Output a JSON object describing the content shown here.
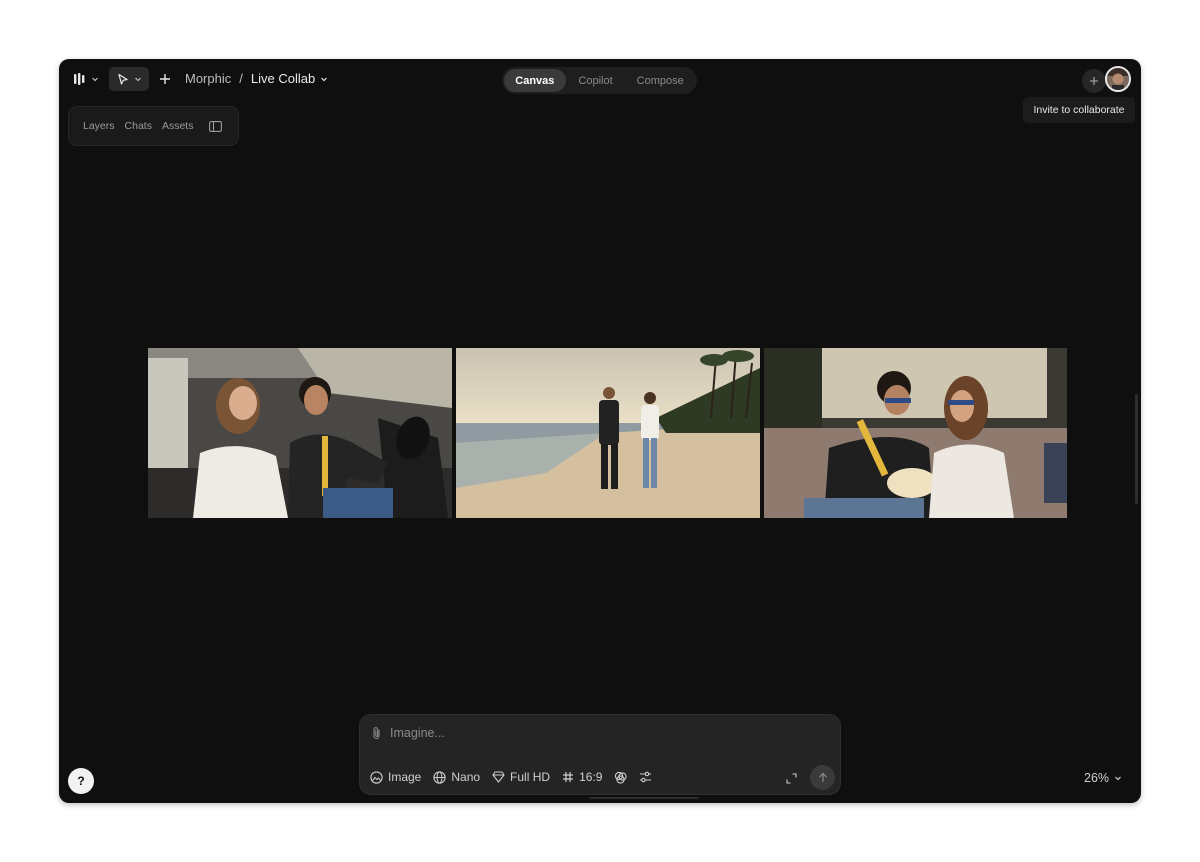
{
  "header": {
    "breadcrumb_root": "Morphic",
    "breadcrumb_separator": "/",
    "breadcrumb_current": "Live Collab",
    "modes": [
      {
        "label": "Canvas",
        "active": true
      },
      {
        "label": "Copilot",
        "active": false
      },
      {
        "label": "Compose",
        "active": false
      }
    ],
    "tooltip": "Invite to collaborate"
  },
  "panel": {
    "tabs": [
      "Layers",
      "Chats",
      "Assets"
    ]
  },
  "canvas": {
    "images": [
      {
        "name": "couple-in-car"
      },
      {
        "name": "couple-walking-beach"
      },
      {
        "name": "couple-watching-movie"
      }
    ]
  },
  "prompt": {
    "placeholder": "Imagine...",
    "tools": {
      "type": "Image",
      "model": "Nano",
      "resolution": "Full HD",
      "aspect": "16:9"
    }
  },
  "footer": {
    "help": "?",
    "zoom": "26%"
  },
  "colors": {
    "window_bg": "#0f0f0f",
    "panel_bg": "#1a1a1a",
    "prompt_bg": "#242424",
    "active_tab": "#3a3a3a"
  }
}
